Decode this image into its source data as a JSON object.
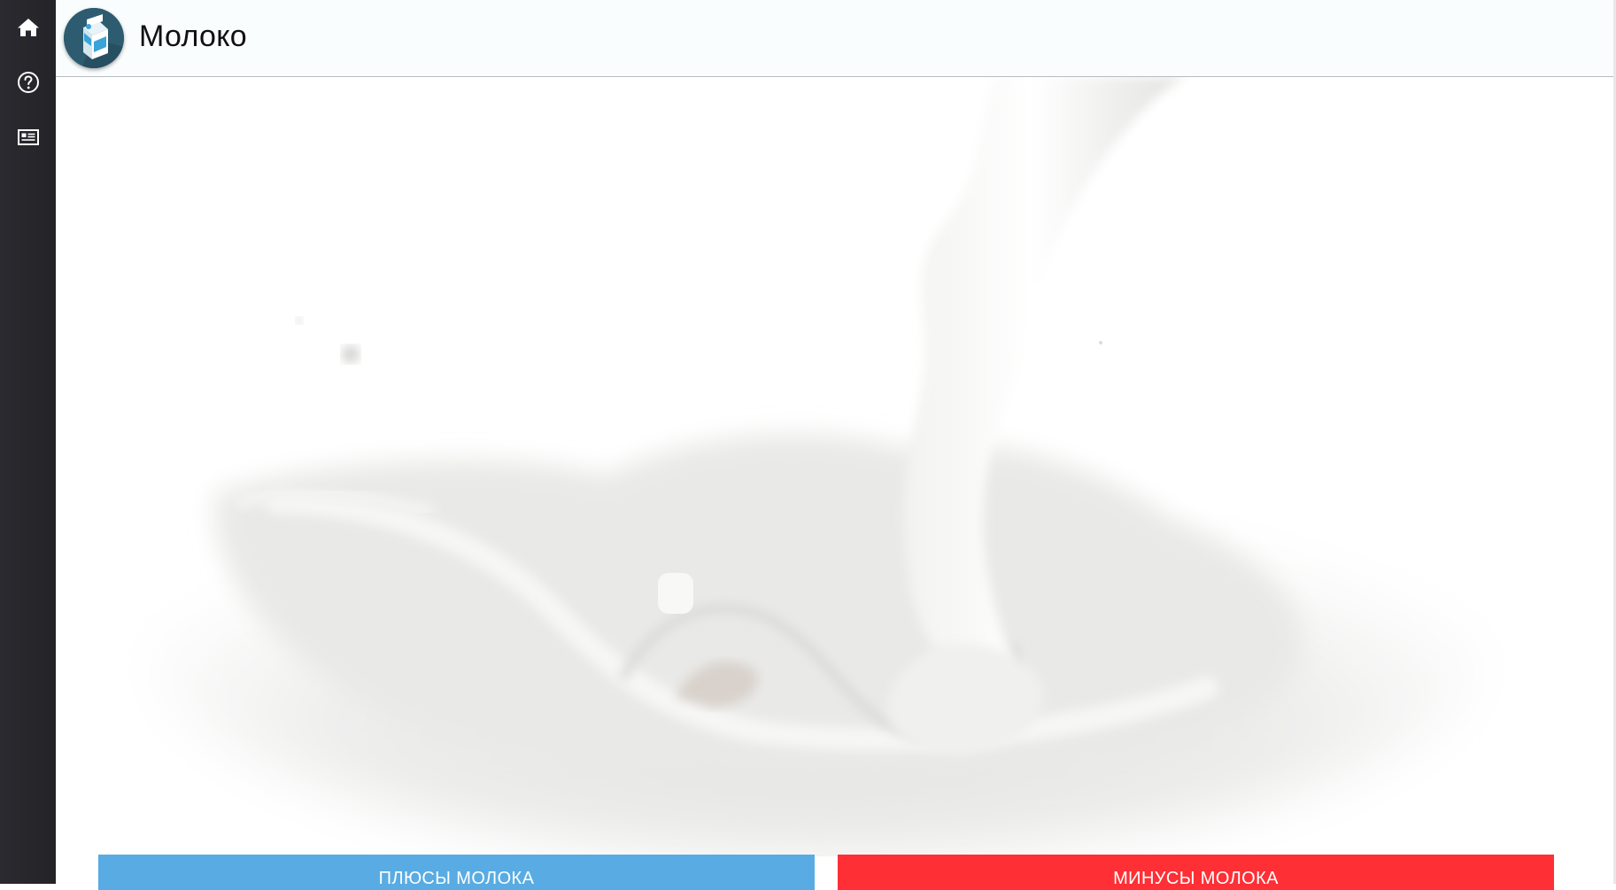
{
  "app": {
    "title": "Молоко"
  },
  "sidebar": {
    "items": [
      {
        "icon": "home-icon"
      },
      {
        "icon": "help-icon"
      },
      {
        "icon": "news-icon"
      }
    ]
  },
  "buttons": {
    "plus_label": "ПЛЮСЫ МОЛОКА",
    "minus_label": "МИНУСЫ МОЛОКА"
  },
  "colors": {
    "sidebar_bg": "#26262b",
    "topbar_bg": "#f9fdfe",
    "plus_button": "#58ace3",
    "minus_button": "#fe2f35"
  }
}
